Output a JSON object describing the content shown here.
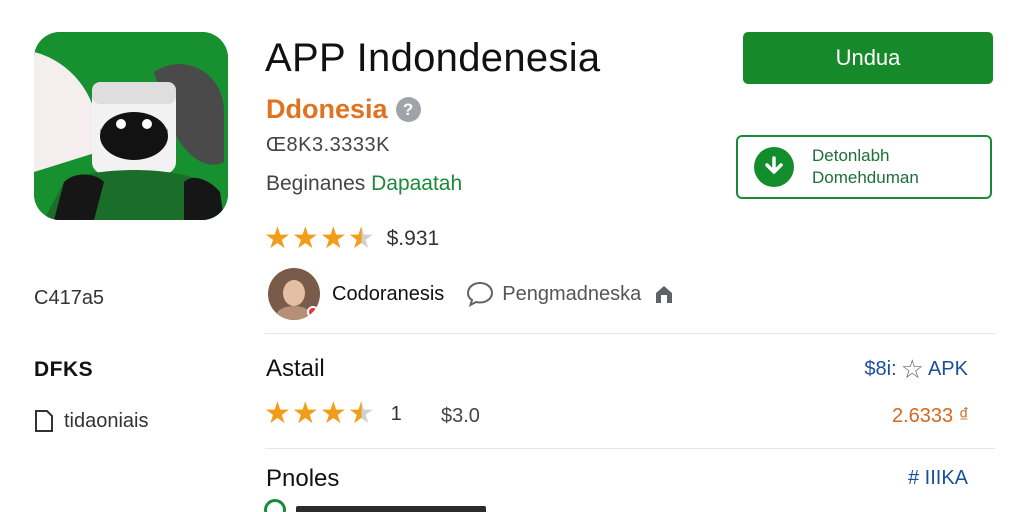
{
  "app": {
    "title": "APP Indondenesia",
    "developer": "Ddonesia",
    "help_glyph": "?",
    "downloads": "Œ8K3.3​333K",
    "category_prefix": "Bеginaneѕ",
    "category_link": "Dapaatah",
    "rating_value": 3.5,
    "rating_text": "$.931",
    "icon": "app-mascot-icon"
  },
  "actions": {
    "install_label": "Undua",
    "download_line1": "Detonlabh",
    "download_line2": "Domehduman"
  },
  "author": {
    "name": "Codoranesis",
    "status": "Pengmadneska",
    "chat_icon": "chat-bubble-icon",
    "home_icon": "home-icon"
  },
  "left_meta": {
    "a": "C417a5",
    "b": "DFKS",
    "c": "tidaoniais"
  },
  "section1": {
    "title": "Astail",
    "link_prefix": "$8i:",
    "link_suffix": "APK",
    "rating_value": 3.5,
    "count": "1",
    "size": "$3.0",
    "price": "2.6333 ₫"
  },
  "section2": {
    "title": "Pnoles",
    "link": "# IIIKA"
  },
  "colors": {
    "brand_green": "#168a2a",
    "developer_orange": "#e0731f",
    "star": "#f29d1a",
    "link_blue": "#1a4f9e"
  }
}
